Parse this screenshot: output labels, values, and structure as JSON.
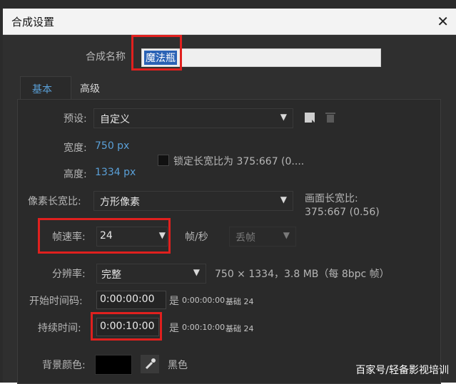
{
  "dialog": {
    "title": "合成设置",
    "close_glyph": "✕"
  },
  "composition_name": {
    "label": "合成名称",
    "value": "魔法瓶"
  },
  "tabs": [
    {
      "label": "基本"
    },
    {
      "label": "高级"
    }
  ],
  "preset": {
    "label": "预设:",
    "value": "自定义"
  },
  "width": {
    "label": "宽度:",
    "value": "750 px"
  },
  "height": {
    "label": "高度:",
    "value": "1334 px"
  },
  "lock_aspect": {
    "label": "锁定长宽比为 375:667 (0...."
  },
  "pixel_aspect": {
    "label": "像素长宽比:",
    "value": "方形像素"
  },
  "frame_aspect": {
    "label": "画面长宽比:",
    "value": "375:667 (0.56)"
  },
  "frame_rate": {
    "label": "帧速率:",
    "value": "24",
    "unit": "帧/秒",
    "drop_label": "丢帧"
  },
  "resolution": {
    "label": "分辨率:",
    "value": "完整",
    "info": "750 × 1334，3.8 MB（每 8bpc 帧）"
  },
  "start_timecode": {
    "label": "开始时间码:",
    "value": "0:00:00:00",
    "note_prefix": "是",
    "note_small": "0:00:00:00",
    "note_suffix": "基础 24"
  },
  "duration": {
    "label": "持续时间:",
    "value": "0:00:10:00",
    "note_prefix": "是",
    "note_small": "0:00:10:00",
    "note_suffix": "基础 24"
  },
  "background": {
    "label": "背景颜色:",
    "color_name": "黑色",
    "color": "#000000"
  },
  "watermark": "百家号/轻备影视培训",
  "colors": {
    "accent": "#5aa0d8",
    "highlight": "#e0201e"
  }
}
